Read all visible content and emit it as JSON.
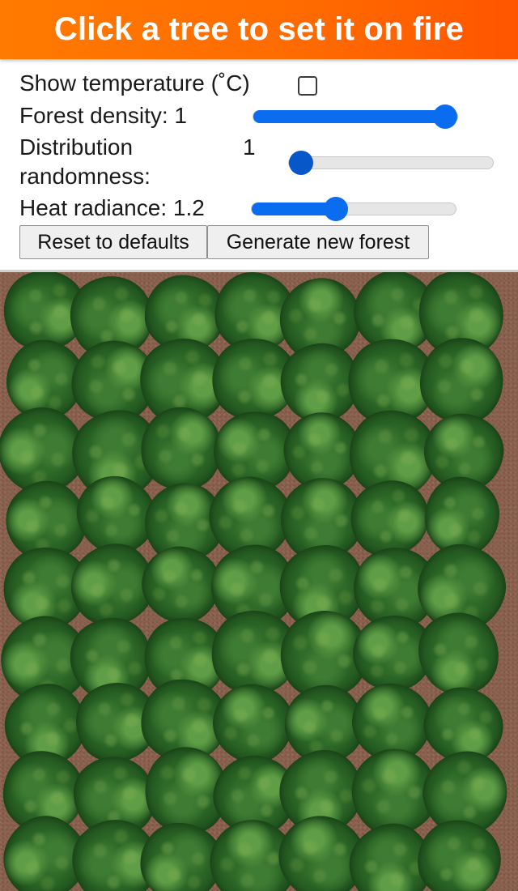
{
  "banner": {
    "title": "Click a tree to set it on fire"
  },
  "controls": {
    "show_temperature": {
      "label": "Show temperature (˚C)",
      "checked": false
    },
    "forest_density": {
      "label": "Forest density:",
      "value": "1",
      "fraction": 1.0
    },
    "distribution_randomness": {
      "label_line1": "Distribution",
      "label_line2": "randomness:",
      "value": "1",
      "fraction": 0.0
    },
    "heat_radiance": {
      "label": "Heat radiance:",
      "value": "1.2",
      "fraction": 0.4
    }
  },
  "buttons": {
    "reset": "Reset to defaults",
    "generate": "Generate new forest"
  },
  "forest": {
    "columns": 7,
    "rows": 9,
    "ground_color": "#8a5f4c",
    "tree_color": "#2e6a28"
  }
}
